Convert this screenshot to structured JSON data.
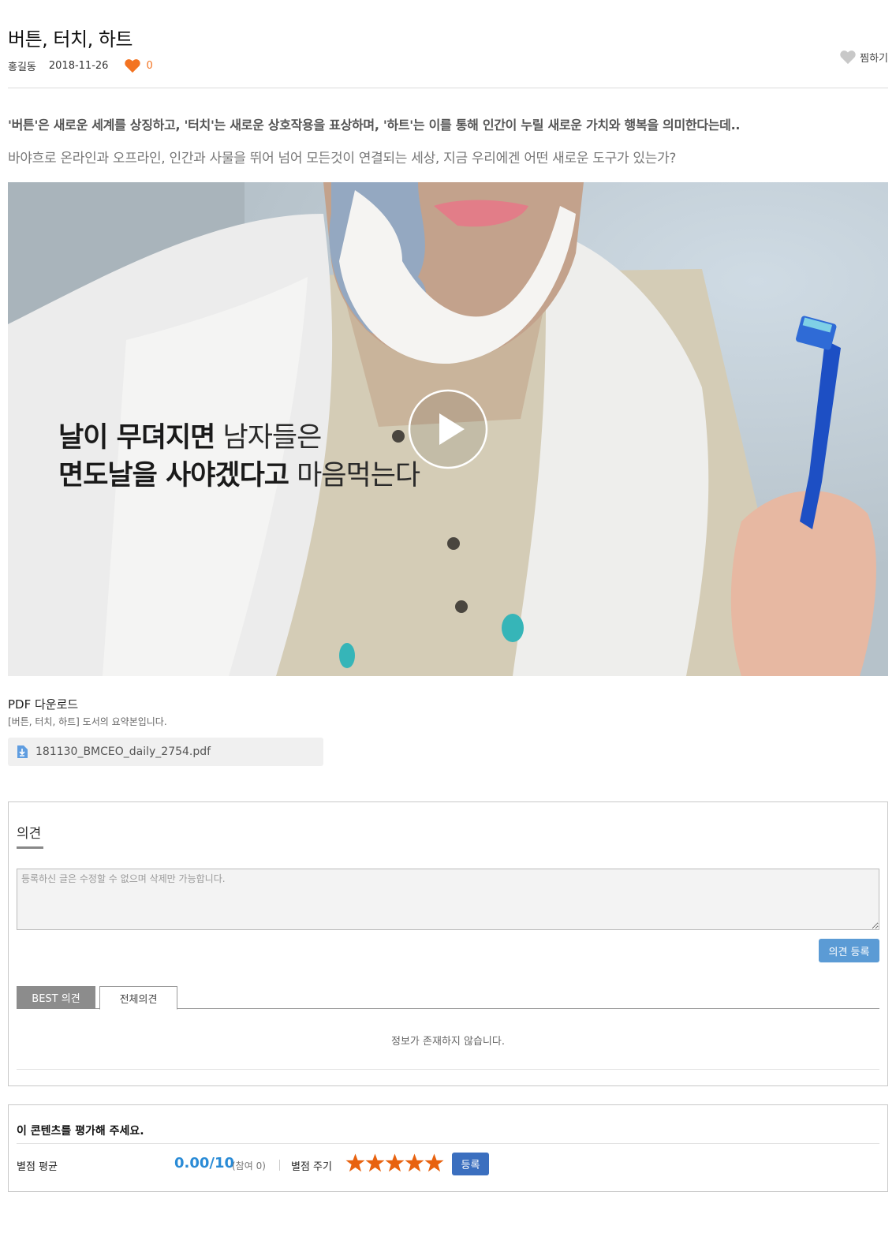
{
  "article": {
    "title": "버튼, 터치, 하트",
    "author": "홍길동",
    "date": "2018-11-26",
    "like_count": "0",
    "wish_label": "찜하기",
    "lead": "'버튼'은 새로운 세계를 상징하고, '터치'는 새로운 상호작용을 표상하며, '하트'는 이를 통해 인간이 누릴 새로운 가치와 행복을 의미한다는데..",
    "sub": "바야흐로 온라인과 오프라인, 인간과 사물을 뛰어 넘어 모든것이 연결되는 세상, 지금 우리에겐 어떤 새로운 도구가 있는가?"
  },
  "video": {
    "caption_line1_bold": "날이 무뎌지면",
    "caption_line1_rest": " 남자들은",
    "caption_line2_bold": "면도날을 사야겠다고",
    "caption_line2_rest": " 마음먹는다"
  },
  "pdf": {
    "title": "PDF 다운로드",
    "description": "[버튼, 터치, 하트] 도서의 요약본입니다.",
    "filename": "181130_BMCEO_daily_2754.pdf"
  },
  "opinion": {
    "heading": "의견",
    "placeholder": "등록하신 글은 수정할 수 없으며 삭제만 가능합니다.",
    "submit_label": "의견 등록",
    "tabs": [
      {
        "label": "BEST 의견",
        "active": true
      },
      {
        "label": "전체의견",
        "active": false
      }
    ],
    "empty_message": "정보가 존재하지 않습니다."
  },
  "rating": {
    "question": "이 콘텐츠를 평가해 주세요.",
    "avg_label": "별점 평균",
    "avg_value": "0.00/10",
    "participants": "(참여 0)",
    "give_label": "별점 주기",
    "stars_selected": 5,
    "stars_total": 5,
    "register_label": "등록"
  },
  "colors": {
    "like_heart": "#f37321",
    "wish_heart": "#c8c8c8",
    "star": "#e8620f",
    "submit_button": "#5b9bd5",
    "register_button": "#3b6fbf",
    "avg_value": "#2a8bd6"
  }
}
